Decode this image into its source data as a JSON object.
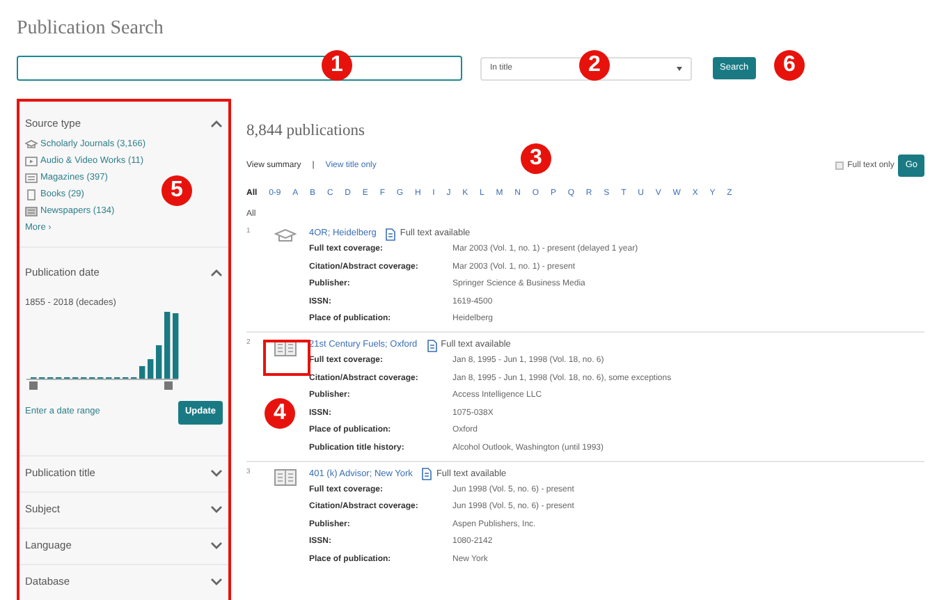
{
  "title": "Publication Search",
  "search": {
    "scope": "In title",
    "button": "Search"
  },
  "sidebar": {
    "source_type": {
      "title": "Source type",
      "expanded": true,
      "items": [
        {
          "kind": "journal",
          "label": "Scholarly Journals (3,166)"
        },
        {
          "kind": "video",
          "label": "Audio & Video Works (11)"
        },
        {
          "kind": "magazine",
          "label": "Magazines (397)"
        },
        {
          "kind": "book",
          "label": "Books (29)"
        },
        {
          "kind": "newspaper",
          "label": "Newspapers (134)"
        }
      ],
      "more": "More ›"
    },
    "publication_date": {
      "title": "Publication date",
      "expanded": true,
      "range": "1855 - 2018 (decades)",
      "link": "Enter a date range",
      "button": "Update"
    },
    "sections": [
      {
        "title": "Publication title",
        "expanded": false
      },
      {
        "title": "Subject",
        "expanded": false
      },
      {
        "title": "Language",
        "expanded": false
      },
      {
        "title": "Database",
        "expanded": false
      }
    ]
  },
  "results": {
    "count": "8,844 publications",
    "views": [
      {
        "label": "View summary",
        "selected": true
      },
      {
        "label": "View title only",
        "selected": false
      }
    ],
    "separator": "|",
    "full_text_only": {
      "label": "Full text only",
      "checked": false
    },
    "go": "Go",
    "letters": [
      {
        "label": "All",
        "selected": true
      },
      {
        "label": "0-9",
        "selected": false
      },
      {
        "label": "A",
        "selected": false
      },
      {
        "label": "B",
        "selected": false
      },
      {
        "label": "C",
        "selected": false
      },
      {
        "label": "D",
        "selected": false
      },
      {
        "label": "E",
        "selected": false
      },
      {
        "label": "F",
        "selected": false
      },
      {
        "label": "G",
        "selected": false
      },
      {
        "label": "H",
        "selected": false
      },
      {
        "label": "I",
        "selected": false
      },
      {
        "label": "J",
        "selected": false
      },
      {
        "label": "K",
        "selected": false
      },
      {
        "label": "L",
        "selected": false
      },
      {
        "label": "M",
        "selected": false
      },
      {
        "label": "N",
        "selected": false
      },
      {
        "label": "O",
        "selected": false
      },
      {
        "label": "P",
        "selected": false
      },
      {
        "label": "Q",
        "selected": false
      },
      {
        "label": "R",
        "selected": false
      },
      {
        "label": "S",
        "selected": false
      },
      {
        "label": "T",
        "selected": false
      },
      {
        "label": "U",
        "selected": false
      },
      {
        "label": "V",
        "selected": false
      },
      {
        "label": "W",
        "selected": false
      },
      {
        "label": "X",
        "selected": false
      },
      {
        "label": "Y",
        "selected": false
      },
      {
        "label": "Z",
        "selected": false
      }
    ],
    "group": "All",
    "items": [
      {
        "number": "1",
        "kind": "journal",
        "title": "4OR; Heidelberg",
        "full_text": "Full text available",
        "fields": [
          [
            "Full text coverage:",
            "Mar 2003 (Vol. 1, no. 1) - present (delayed 1 year)"
          ],
          [
            "Citation/Abstract coverage:",
            "Mar 2003 (Vol. 1, no. 1) - present"
          ],
          [
            "Publisher:",
            "Springer Science & Business Media"
          ],
          [
            "ISSN:",
            "1619-4500"
          ],
          [
            "Place of publication:",
            "Heidelberg"
          ]
        ]
      },
      {
        "number": "2",
        "kind": "book",
        "title": "21st Century Fuels; Oxford",
        "full_text": "Full text available",
        "fields": [
          [
            "Full text coverage:",
            "Jan 8, 1995 - Jun 1, 1998 (Vol. 18, no. 6)"
          ],
          [
            "Citation/Abstract coverage:",
            "Jan 8, 1995 - Jun 1, 1998 (Vol. 18, no. 6), some exceptions"
          ],
          [
            "Publisher:",
            "Access Intelligence LLC"
          ],
          [
            "ISSN:",
            "1075-038X"
          ],
          [
            "Place of publication:",
            "Oxford"
          ],
          [
            "Publication title history:",
            "Alcohol Outlook, Washington (until 1993)"
          ]
        ]
      },
      {
        "number": "3",
        "kind": "book",
        "title": "401 (k) Advisor; New York",
        "full_text": "Full text available",
        "fields": [
          [
            "Full text coverage:",
            "Jun 1998 (Vol. 5, no. 6) - present"
          ],
          [
            "Citation/Abstract coverage:",
            "Jun 1998 (Vol. 5, no. 6) - present"
          ],
          [
            "Publisher:",
            "Aspen Publishers, Inc."
          ],
          [
            "ISSN:",
            "1080-2142"
          ],
          [
            "Place of publication:",
            "New York"
          ]
        ]
      }
    ]
  },
  "callouts": [
    "1",
    "2",
    "3",
    "4",
    "5",
    "6"
  ]
}
